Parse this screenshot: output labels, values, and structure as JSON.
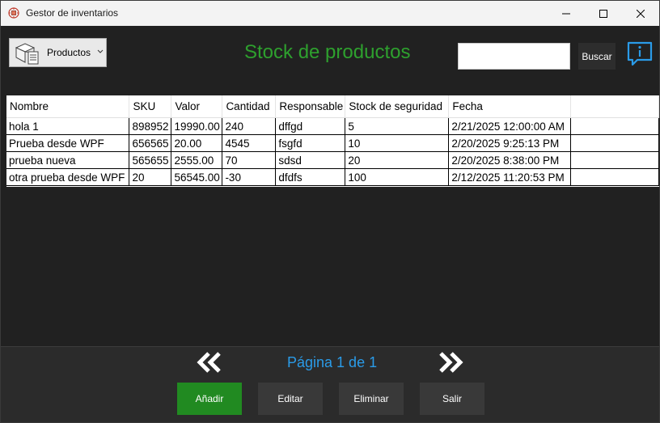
{
  "window": {
    "title": "Gestor de inventarios"
  },
  "toolbar": {
    "products_label": "Productos",
    "page_title": "Stock de productos",
    "search_value": "",
    "search_button": "Buscar"
  },
  "table": {
    "columns": [
      "Nombre",
      "SKU",
      "Valor",
      "Cantidad",
      "Responsable",
      "Stock de seguridad",
      "Fecha"
    ],
    "rows": [
      [
        "hola 1",
        "898952",
        "19990.00",
        "240",
        "dffgd",
        "5",
        "2/21/2025 12:00:00 AM"
      ],
      [
        "Prueba desde WPF",
        "656565",
        "20.00",
        "4545",
        "fsgfd",
        "10",
        "2/20/2025 9:25:13 PM"
      ],
      [
        "prueba nueva",
        "565655",
        "2555.00",
        "70",
        "sdsd",
        "20",
        "2/20/2025 8:38:00 PM"
      ],
      [
        "otra prueba desde WPF",
        "20",
        "56545.00",
        "-30",
        "dfdfs",
        "100",
        "2/12/2025 11:20:53 PM"
      ]
    ]
  },
  "pagination": {
    "label": "Página 1 de 1"
  },
  "actions": {
    "add": "Añadir",
    "edit": "Editar",
    "delete": "Eliminar",
    "exit": "Salir"
  },
  "colors": {
    "title_green": "#2ea02e",
    "page_blue": "#2a9be8",
    "add_green": "#218a21",
    "button_dark": "#393939",
    "background": "#212121"
  },
  "icons": [
    "app-icon",
    "minimize-icon",
    "maximize-icon",
    "close-icon",
    "products-box-icon",
    "chevron-down-icon",
    "info-chat-icon",
    "double-chevron-left-icon",
    "double-chevron-right-icon"
  ]
}
